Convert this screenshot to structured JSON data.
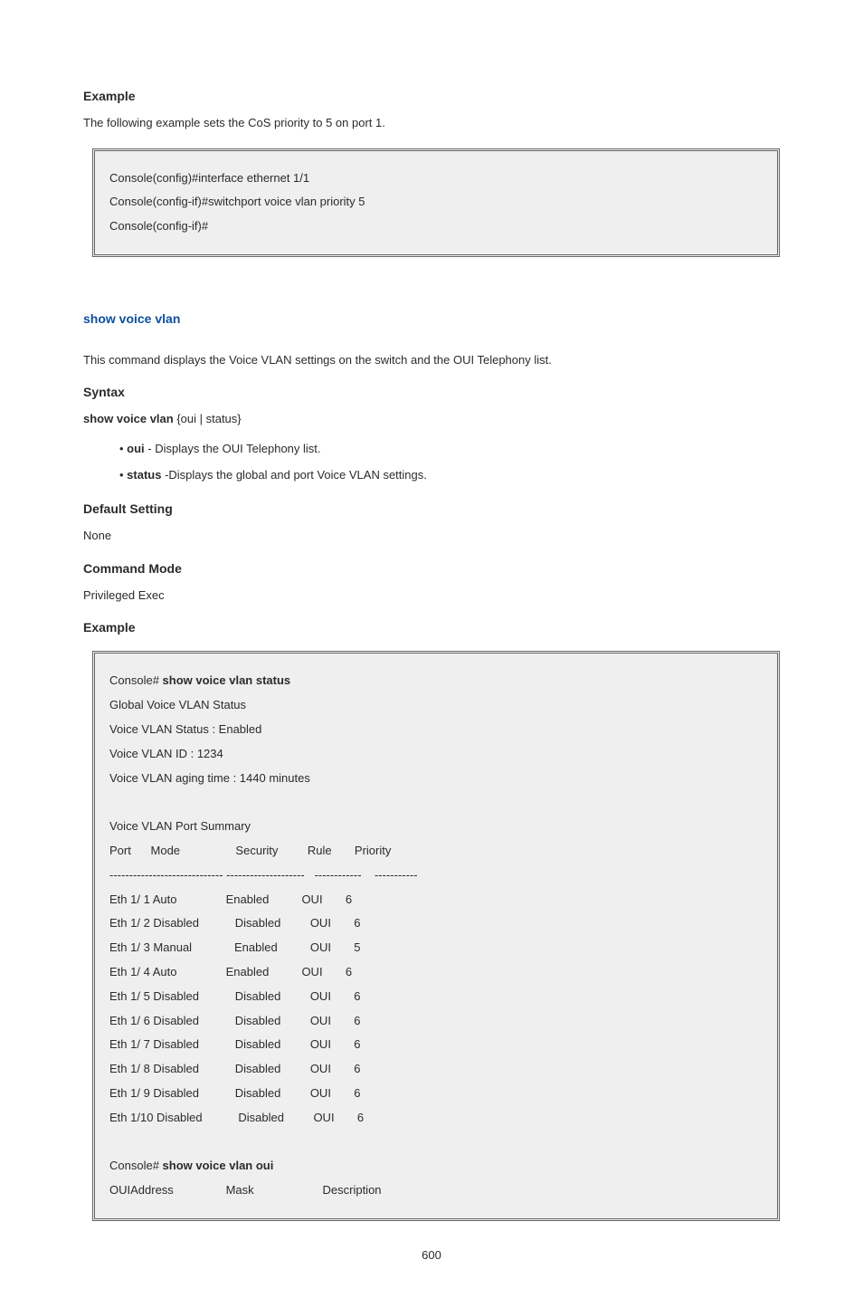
{
  "sections": {
    "example1_heading": "Example",
    "example1_text": "The following example sets the CoS priority to 5 on port 1.",
    "code1": {
      "l1": "Console(config)#interface ethernet 1/1",
      "l2": "Console(config-if)#switchport voice vlan priority 5",
      "l3": "Console(config-if)#"
    },
    "cmd_link": "show voice vlan",
    "cmd_desc": "This command displays the Voice VLAN settings on the switch and the OUI Telephony list.",
    "syntax_heading": "Syntax",
    "syntax_cmd_bold": "show voice vlan",
    "syntax_cmd_rest": " {oui | status}",
    "syntax_opt1_bold": "oui",
    "syntax_opt1_rest": " - Displays the OUI Telephony list.",
    "syntax_opt2_bold": "status",
    "syntax_opt2_rest": " -Displays the global and port Voice VLAN settings.",
    "default_heading": "Default Setting",
    "default_value": "None",
    "mode_heading": "Command Mode",
    "mode_value": "Privileged Exec",
    "example2_heading": "Example"
  },
  "code2": {
    "console_prefix": "Console#",
    "cmd_status": " show voice vlan status",
    "global_heading": "Global Voice VLAN Status",
    "status_line": "Voice VLAN Status : Enabled",
    "id_line": "Voice VLAN ID : 1234",
    "aging_line": "Voice VLAN aging time : 1440 minutes",
    "summary_heading": "Voice VLAN Port Summary",
    "hdr": "Port      Mode                 Security         Rule       Priority",
    "sep": "----------------------------- --------------------   ------------    -----------",
    "rows": [
      "Eth 1/ 1 Auto               Enabled          OUI       6",
      "Eth 1/ 2 Disabled           Disabled         OUI       6",
      "Eth 1/ 3 Manual             Enabled          OUI       5",
      "Eth 1/ 4 Auto               Enabled          OUI       6",
      "Eth 1/ 5 Disabled           Disabled         OUI       6",
      "Eth 1/ 6 Disabled           Disabled         OUI       6",
      "Eth 1/ 7 Disabled           Disabled         OUI       6",
      "Eth 1/ 8 Disabled           Disabled         OUI       6",
      "Eth 1/ 9 Disabled           Disabled         OUI       6",
      "Eth 1/10 Disabled           Disabled         OUI       6"
    ],
    "cmd_oui": " show voice vlan oui",
    "oui_hdr": "OUIAddress                Mask                     Description"
  },
  "page_number": "600",
  "chart_data": {
    "type": "table",
    "title": "Voice VLAN Port Summary",
    "columns": [
      "Port",
      "Mode",
      "Security",
      "Rule",
      "Priority"
    ],
    "rows": [
      [
        "Eth 1/ 1",
        "Auto",
        "Enabled",
        "OUI",
        6
      ],
      [
        "Eth 1/ 2",
        "Disabled",
        "Disabled",
        "OUI",
        6
      ],
      [
        "Eth 1/ 3",
        "Manual",
        "Enabled",
        "OUI",
        5
      ],
      [
        "Eth 1/ 4",
        "Auto",
        "Enabled",
        "OUI",
        6
      ],
      [
        "Eth 1/ 5",
        "Disabled",
        "Disabled",
        "OUI",
        6
      ],
      [
        "Eth 1/ 6",
        "Disabled",
        "Disabled",
        "OUI",
        6
      ],
      [
        "Eth 1/ 7",
        "Disabled",
        "Disabled",
        "OUI",
        6
      ],
      [
        "Eth 1/ 8",
        "Disabled",
        "Disabled",
        "OUI",
        6
      ],
      [
        "Eth 1/ 9",
        "Disabled",
        "Disabled",
        "OUI",
        6
      ],
      [
        "Eth 1/10",
        "Disabled",
        "Disabled",
        "OUI",
        6
      ]
    ]
  }
}
